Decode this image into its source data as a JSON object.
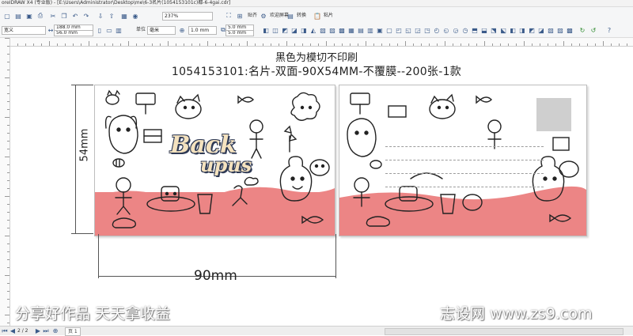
{
  "app": {
    "title": "oreIDRAW X4 (专业版) - [E:\\Users\\Administrator\\Desktop\\me\\6-3名片(1054153101c)都-6-4gai.cdr]"
  },
  "toolbar": {
    "zoom_value": "237%",
    "snap_label": "贴齐",
    "welcome_label": "欢迎屏幕",
    "launcher_label": "转换",
    "paste_label": "粘片"
  },
  "propertybar": {
    "paper_type": "宽义",
    "width_value": "188.0 mm",
    "height_value": "56.0 mm",
    "units_label": "单位",
    "units_value": "毫米",
    "nudge_value": "1.0 mm",
    "dup_x_value": "5.0 mm",
    "dup_y_value": "5.0 mm"
  },
  "document": {
    "heading": "黑色为模切不印刷",
    "subheading": "1054153101:名片-双面-90X54MM-不覆膜--200张-1款",
    "logo_text_1": "Back",
    "logo_text_2": "upus",
    "dimension_height": "54mm",
    "dimension_width": "90mm"
  },
  "watermark": {
    "left_text": "分享好作品 天天拿收益",
    "right_text": "志设网 www.zs9.com"
  },
  "statusbar": {
    "page_indicator": "2 / 2",
    "page_tab": "页 1"
  },
  "colors": {
    "pink_band": "#ec8585",
    "logo_fill": "#f4e2bf",
    "logo_outline": "#2f3a55"
  }
}
